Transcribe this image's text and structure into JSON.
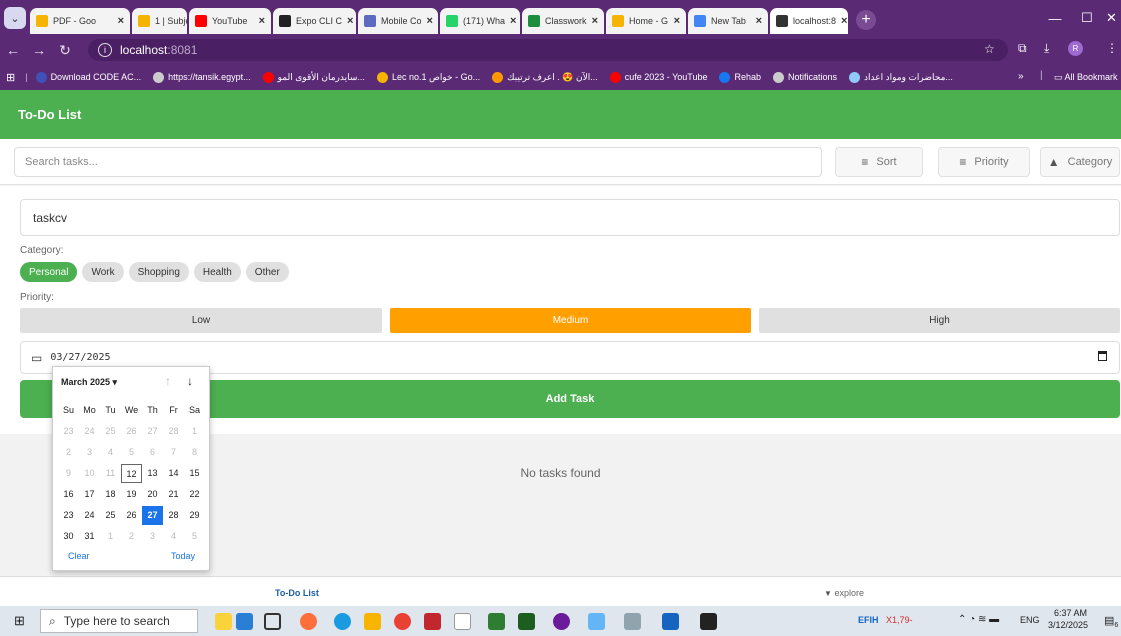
{
  "browser": {
    "tabs": [
      {
        "title": "PDF - Goo",
        "color": "#f4b400"
      },
      {
        "title": "1 | Subject",
        "color": "#f4b400"
      },
      {
        "title": "YouTube",
        "color": "#ff0000"
      },
      {
        "title": "Expo CLI C",
        "color": "#222222"
      },
      {
        "title": "Mobile Co",
        "color": "#5c6bc0"
      },
      {
        "title": "(171) Wha",
        "color": "#25d366"
      },
      {
        "title": "Classwork",
        "color": "#1e8e3e"
      },
      {
        "title": "Home - G",
        "color": "#f4b400"
      },
      {
        "title": "New Tab",
        "color": "#4285f4"
      },
      {
        "title": "localhost:8",
        "color": "#333333"
      }
    ],
    "address": {
      "host": "localhost",
      "port": ":8081"
    },
    "bookmarks": [
      {
        "label": "Download CODE AC...",
        "color": "#3f51b5"
      },
      {
        "label": "https://tansik.egypt...",
        "color": "#cccccc"
      },
      {
        "label": "سايدرمان الأقوى المو...",
        "color": "#ff0000"
      },
      {
        "label": "Lec no.1 خواص - Go...",
        "color": "#f4b400"
      },
      {
        "label": "الآن 😍 . اعرف ترتيبك...",
        "color": "#ff9800"
      },
      {
        "label": "cufe 2023 - YouTube",
        "color": "#ff0000"
      },
      {
        "label": "Rehab",
        "color": "#1877f2"
      },
      {
        "label": "Notifications",
        "color": "#cccccc"
      },
      {
        "label": "محاضرات ومواد اعداد...",
        "color": "#90caf9"
      }
    ],
    "bookmarks_more": "»",
    "all_bookmarks": "All Bookmark"
  },
  "app": {
    "title": "To-Do List",
    "search_placeholder": "Search tasks...",
    "sort_label": "Sort",
    "priority_label": "Priority",
    "category_label": "Category",
    "task_value": "taskcv",
    "category_heading": "Category:",
    "categories": [
      "Personal",
      "Work",
      "Shopping",
      "Health",
      "Other"
    ],
    "selected_category": "Personal",
    "priority_heading": "Priority:",
    "priorities": [
      "Low",
      "Medium",
      "High"
    ],
    "selected_priority": "Medium",
    "date_value": "03/27/2025",
    "add_button": "Add Task",
    "empty_message": "No tasks found",
    "footer_tabs": [
      "To-Do List",
      "explore"
    ]
  },
  "datepicker": {
    "month_label": "March 2025 ▾",
    "weekdays": [
      "Su",
      "Mo",
      "Tu",
      "We",
      "Th",
      "Fr",
      "Sa"
    ],
    "weeks": [
      [
        "23",
        "24",
        "25",
        "26",
        "27",
        "28",
        "1"
      ],
      [
        "2",
        "3",
        "4",
        "5",
        "6",
        "7",
        "8"
      ],
      [
        "9",
        "10",
        "11",
        "12",
        "13",
        "14",
        "15"
      ],
      [
        "16",
        "17",
        "18",
        "19",
        "20",
        "21",
        "22"
      ],
      [
        "23",
        "24",
        "25",
        "26",
        "27",
        "28",
        "29"
      ],
      [
        "30",
        "31",
        "1",
        "2",
        "3",
        "4",
        "5"
      ]
    ],
    "today": "12",
    "selected": "27",
    "clear_label": "Clear",
    "today_label": "Today"
  },
  "taskbar": {
    "search_placeholder": "Type here to search",
    "ticker": "EFIH",
    "ticker_value": "X1,79-",
    "lang": "ENG",
    "time": "6:37 AM",
    "date": "3/12/2025",
    "notif_count": "6"
  }
}
